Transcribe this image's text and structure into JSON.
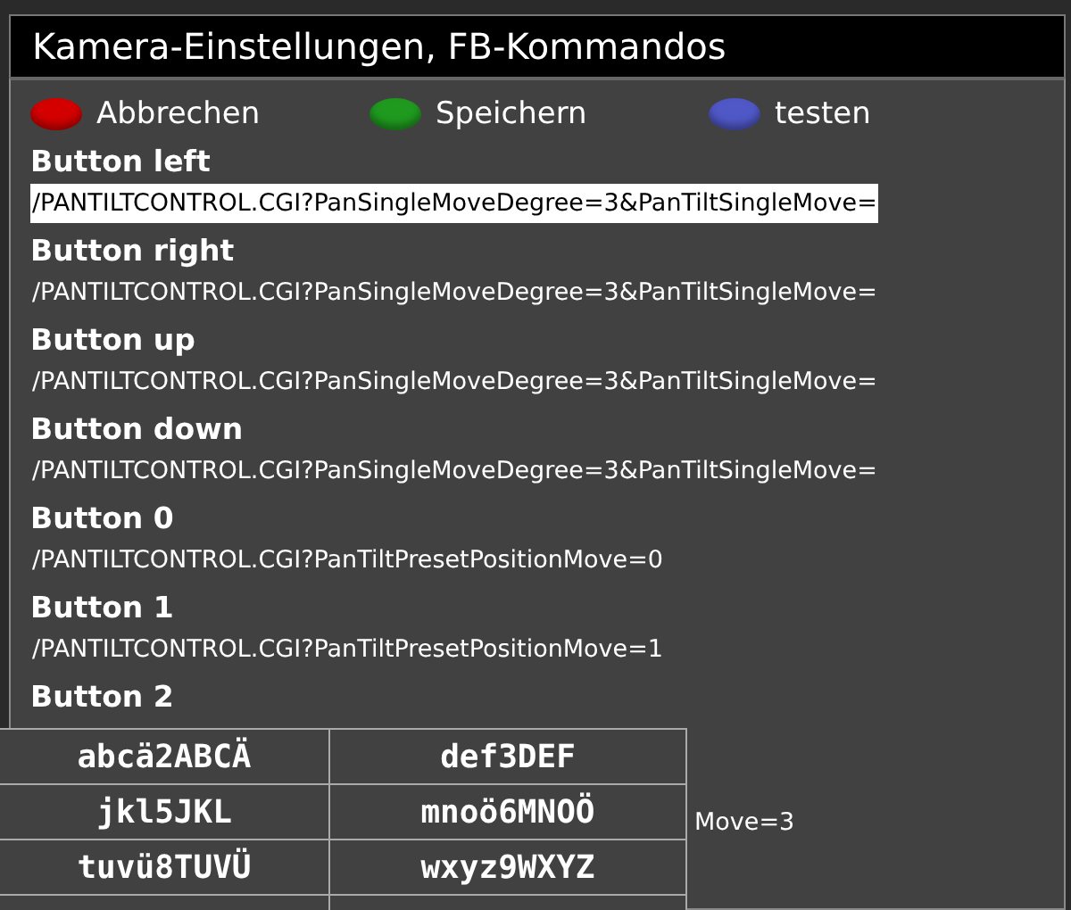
{
  "window": {
    "title": "Kamera-Einstellungen, FB-Kommandos"
  },
  "color_buttons": [
    {
      "label": "Abbrechen",
      "color": "#d40000"
    },
    {
      "label": "Speichern",
      "color": "#1f9a1f"
    },
    {
      "label": "testen",
      "color": "#5058c8"
    }
  ],
  "entries": [
    {
      "label": "Button left",
      "value": "/PANTILTCONTROL.CGI?PanSingleMoveDegree=3&PanTiltSingleMove=",
      "selected": true,
      "covered": false
    },
    {
      "label": "Button right",
      "value": "/PANTILTCONTROL.CGI?PanSingleMoveDegree=3&PanTiltSingleMove=",
      "selected": false,
      "covered": false
    },
    {
      "label": "Button up",
      "value": "/PANTILTCONTROL.CGI?PanSingleMoveDegree=3&PanTiltSingleMove=",
      "selected": false,
      "covered": false
    },
    {
      "label": "Button down",
      "value": "/PANTILTCONTROL.CGI?PanSingleMoveDegree=3&PanTiltSingleMove=",
      "selected": false,
      "covered": false
    },
    {
      "label": "Button 0",
      "value": "/PANTILTCONTROL.CGI?PanTiltPresetPositionMove=0",
      "selected": false,
      "covered": false
    },
    {
      "label": "Button 1",
      "value": "/PANTILTCONTROL.CGI?PanTiltPresetPositionMove=1",
      "selected": false,
      "covered": false
    },
    {
      "label": "Button 2",
      "value": "Move=3",
      "selected": false,
      "covered": true
    }
  ],
  "keyboard": {
    "keys": [
      [
        "abcä2ABCÄ",
        "def3DEF"
      ],
      [
        "jkl5JKL",
        "mnoö6MNOÖ"
      ],
      [
        "tuvü8TUVÜ",
        "wxyz9WXYZ"
      ]
    ]
  }
}
